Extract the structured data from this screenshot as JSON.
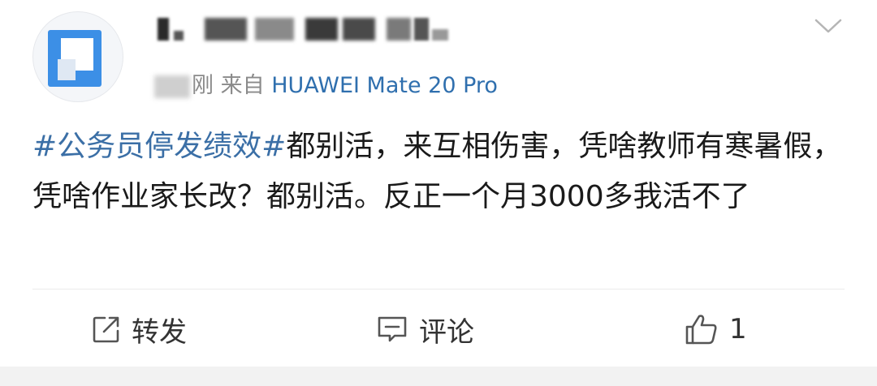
{
  "post": {
    "time_prefix": "刚",
    "source_prefix": "来自",
    "device": "HUAWEI Mate 20 Pro",
    "hashtag": "#公务员停发绩效#",
    "body": "都别活，来互相伤害，凭啥教师有寒暑假，凭啥作业家长改？都别活。反正一个月3000多我活不了"
  },
  "actions": {
    "repost_label": "转发",
    "comment_label": "评论",
    "like_count": "1"
  },
  "icons": {
    "menu": "chevron-down-icon",
    "repost": "share-icon",
    "comment": "comment-icon",
    "like": "thumbs-up-icon"
  }
}
